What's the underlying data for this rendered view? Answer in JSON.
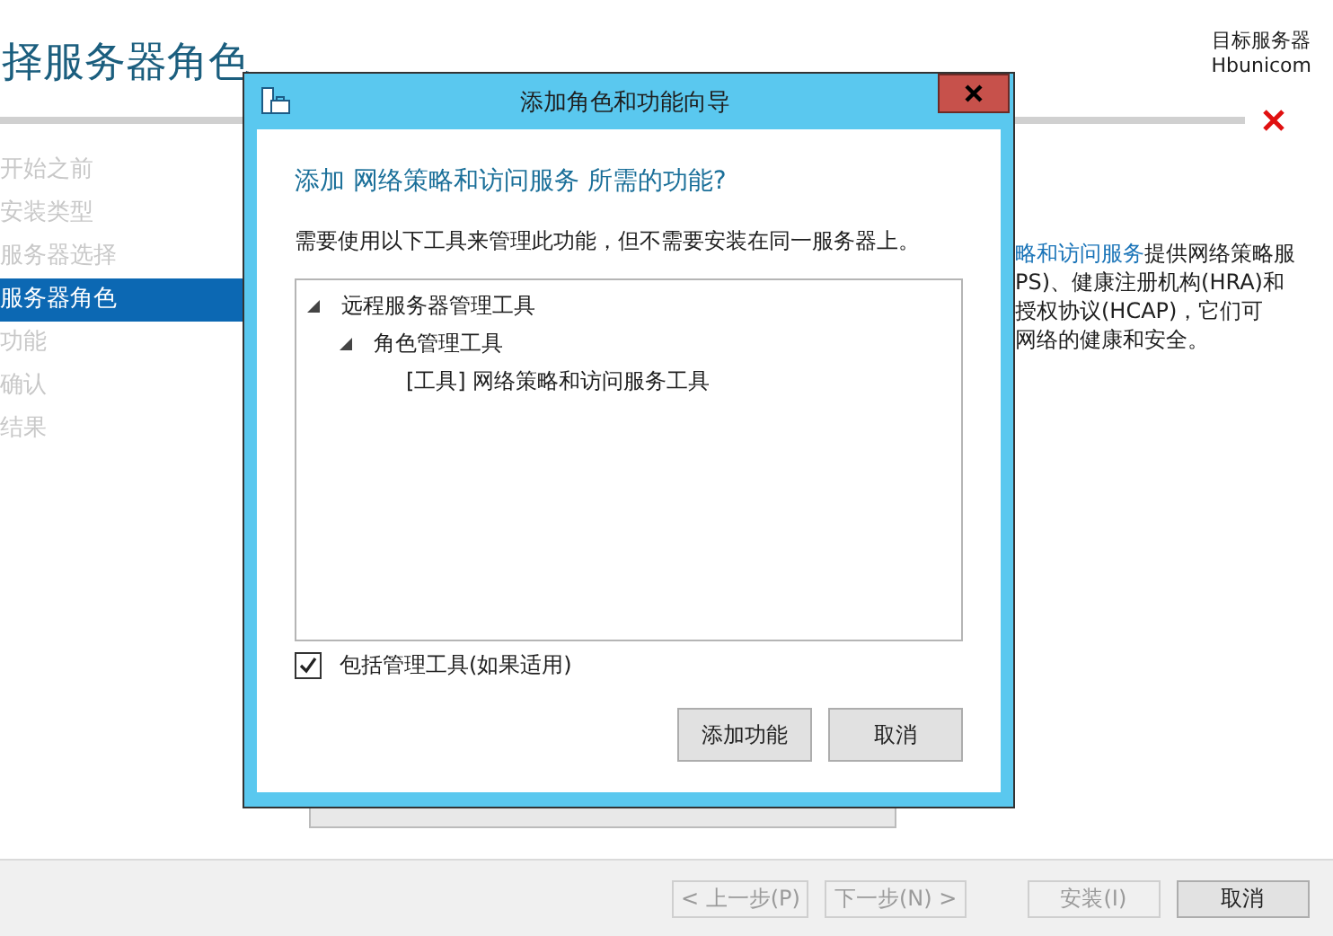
{
  "page": {
    "title": "择服务器角色",
    "target_label": "目标服务器",
    "target_server": "Hbunicom"
  },
  "steps": [
    {
      "label": "开始之前",
      "selected": false
    },
    {
      "label": "安装类型",
      "selected": false
    },
    {
      "label": "服务器选择",
      "selected": false
    },
    {
      "label": "服务器角色",
      "selected": true
    },
    {
      "label": "功能",
      "selected": false
    },
    {
      "label": "确认",
      "selected": false
    },
    {
      "label": "结果",
      "selected": false
    }
  ],
  "description": {
    "link": "略和访问服务",
    "lines": [
      "提供网络策略服",
      "PS)、健康注册机构(HRA)和",
      "授权协议(HCAP)，它们可",
      "网络的健康和安全。"
    ]
  },
  "dialog": {
    "title": "添加角色和功能向导",
    "heading": "添加 网络策略和访问服务 所需的功能?",
    "text": "需要使用以下工具来管理此功能，但不需要安装在同一服务器上。",
    "tree": [
      {
        "label": "远程服务器管理工具",
        "expanded": true,
        "children": [
          {
            "label": "角色管理工具",
            "expanded": true,
            "children": [
              {
                "label": "[工具] 网络策略和访问服务工具"
              }
            ]
          }
        ]
      }
    ],
    "checkbox": {
      "label": "包括管理工具(如果适用)",
      "checked": true
    },
    "buttons": [
      "添加功能",
      "取消"
    ]
  },
  "footer_buttons": [
    {
      "label": "< 上一步(P)",
      "disabled": true
    },
    {
      "label": "下一步(N) >",
      "disabled": true
    },
    {
      "label": "安装(I)",
      "disabled": true
    },
    {
      "label": "取消",
      "disabled": false
    }
  ]
}
